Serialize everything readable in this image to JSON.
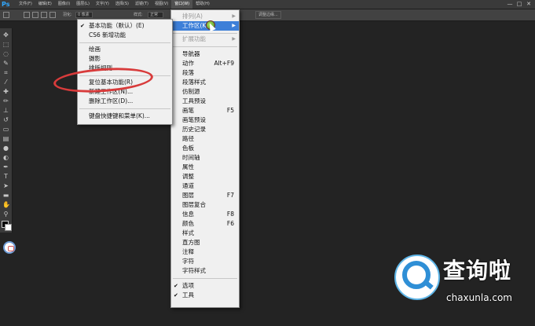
{
  "app": {
    "logo": "Ps"
  },
  "menubar": {
    "items": [
      {
        "label": "文件(F)"
      },
      {
        "label": "编辑(E)"
      },
      {
        "label": "图像(I)"
      },
      {
        "label": "图层(L)"
      },
      {
        "label": "文字(Y)"
      },
      {
        "label": "选择(S)"
      },
      {
        "label": "滤镜(T)"
      },
      {
        "label": "视图(V)"
      },
      {
        "label": "窗口(W)"
      },
      {
        "label": "帮助(H)"
      }
    ],
    "window_controls": {
      "minimize": "—",
      "maximize": "□",
      "close": "✕"
    }
  },
  "options_bar": {
    "feather_label": "羽化:",
    "feather_value": "0 像素",
    "style_label": "样式:",
    "style_value": "正常",
    "refine_label": "调整边缘..."
  },
  "window_menu": {
    "items": [
      {
        "label": "排列(A)",
        "submenu": true,
        "disabled": true
      },
      {
        "label": "工作区(K)",
        "submenu": true,
        "highlight": true
      },
      {
        "label": "扩展功能",
        "submenu": true,
        "disabled": true
      },
      {
        "label": "导航器"
      },
      {
        "label": "动作",
        "shortcut": "Alt+F9"
      },
      {
        "label": "段落"
      },
      {
        "label": "段落样式"
      },
      {
        "label": "仿制源"
      },
      {
        "label": "工具预设"
      },
      {
        "label": "画笔",
        "shortcut": "F5"
      },
      {
        "label": "画笔预设"
      },
      {
        "label": "历史记录"
      },
      {
        "label": "路径"
      },
      {
        "label": "色板"
      },
      {
        "label": "时间轴"
      },
      {
        "label": "属性"
      },
      {
        "label": "调整"
      },
      {
        "label": "通道"
      },
      {
        "label": "图层",
        "shortcut": "F7"
      },
      {
        "label": "图层复合"
      },
      {
        "label": "信息",
        "shortcut": "F8"
      },
      {
        "label": "颜色",
        "shortcut": "F6"
      },
      {
        "label": "样式"
      },
      {
        "label": "直方图"
      },
      {
        "label": "注释"
      },
      {
        "label": "字符"
      },
      {
        "label": "字符样式"
      },
      {
        "label": "选项",
        "checked": true
      },
      {
        "label": "工具",
        "checked": true
      }
    ]
  },
  "workspace_submenu": {
    "items": [
      {
        "label": "基本功能（默认）(E)",
        "checked": true
      },
      {
        "label": "CS6 新增功能"
      },
      {
        "label": "绘画"
      },
      {
        "label": "摄影"
      },
      {
        "label": "排版规则"
      },
      {
        "label": "复位基本功能(R)"
      },
      {
        "label": "新建工作区(N)..."
      },
      {
        "label": "删除工作区(D)..."
      },
      {
        "label": "键盘快捷键和菜单(K)..."
      }
    ]
  },
  "watermark": {
    "title": "查询啦",
    "domain": "chaxunla.com"
  },
  "colors": {
    "highlight": "#3d7fd8",
    "annotation_red": "#d83b3b",
    "watermark_blue": "#2f8fd6"
  }
}
